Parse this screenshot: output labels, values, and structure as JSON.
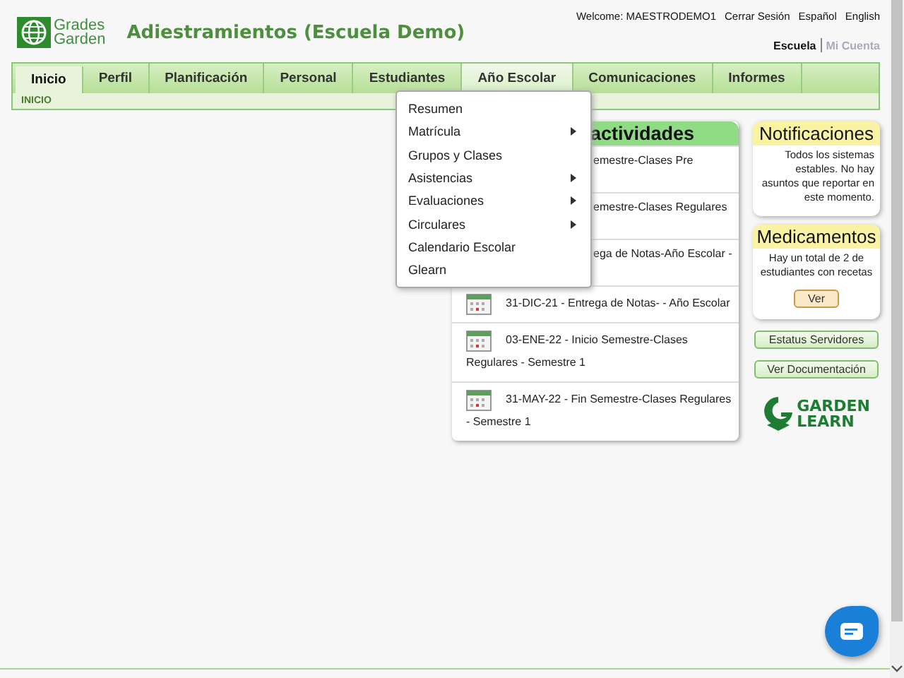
{
  "logo": {
    "line1": "Grades",
    "line2": "Garden"
  },
  "title": "Adiestramientos (Escuela Demo)",
  "top_links": [
    "Welcome: MAESTRODEMO1",
    "Cerrar Sesión",
    "Español",
    "English"
  ],
  "account_links": [
    {
      "label": "Escuela",
      "selected": true
    },
    {
      "label": "Mi Cuenta",
      "selected": false
    }
  ],
  "tabs": [
    {
      "label": "Inicio",
      "selected": true,
      "open": false
    },
    {
      "label": "Perfil",
      "selected": false,
      "open": false
    },
    {
      "label": "Planificación",
      "selected": false,
      "open": false
    },
    {
      "label": "Personal",
      "selected": false,
      "open": false
    },
    {
      "label": "Estudiantes",
      "selected": false,
      "open": false
    },
    {
      "label": "Año Escolar",
      "selected": false,
      "open": true
    },
    {
      "label": "Comunicaciones",
      "selected": false,
      "open": false
    },
    {
      "label": "Informes",
      "selected": false,
      "open": false
    }
  ],
  "breadcrumb": "INICIO",
  "menu": [
    {
      "label": "Resumen",
      "submenu": false
    },
    {
      "label": "Matrícula",
      "submenu": true
    },
    {
      "label": "Grupos y Clases",
      "submenu": false
    },
    {
      "label": "Asistencias",
      "submenu": true
    },
    {
      "label": "Evaluaciones",
      "submenu": true
    },
    {
      "label": "Circulares",
      "submenu": true
    },
    {
      "label": "Calendario Escolar",
      "submenu": false
    },
    {
      "label": "Glearn",
      "submenu": false
    }
  ],
  "activities": {
    "title": "actividades",
    "items": [
      {
        "text": "emestre-Clases Pre",
        "covered": true
      },
      {
        "text": "emestre-Clases Regulares",
        "covered": true
      },
      {
        "text": "ega de Notas-Año Escolar -",
        "covered": true
      },
      {
        "text": "31-DIC-21 - Entrega de Notas- - Año Escolar",
        "covered": false
      },
      {
        "text": "03-ENE-22 - Inicio Semestre-Clases",
        "continued": "Regulares - Semestre 1",
        "covered": false
      },
      {
        "text": "31-MAY-22 - Fin Semestre-Clases Regulares",
        "continued": "- Semestre 1",
        "covered": false
      }
    ]
  },
  "notifications": {
    "title": "Notificaciones",
    "text": "Todos los sistemas estables. No hay asuntos que reportar en este momento."
  },
  "medications": {
    "title": "Medicamentos",
    "text": "Hay un total de 2 de estudiantes con recetas",
    "button": "Ver"
  },
  "side_buttons": [
    "Estatus Servidores",
    "Ver Documentación"
  ],
  "brand": {
    "line1": "GARDEN",
    "line2": "LEARN"
  }
}
